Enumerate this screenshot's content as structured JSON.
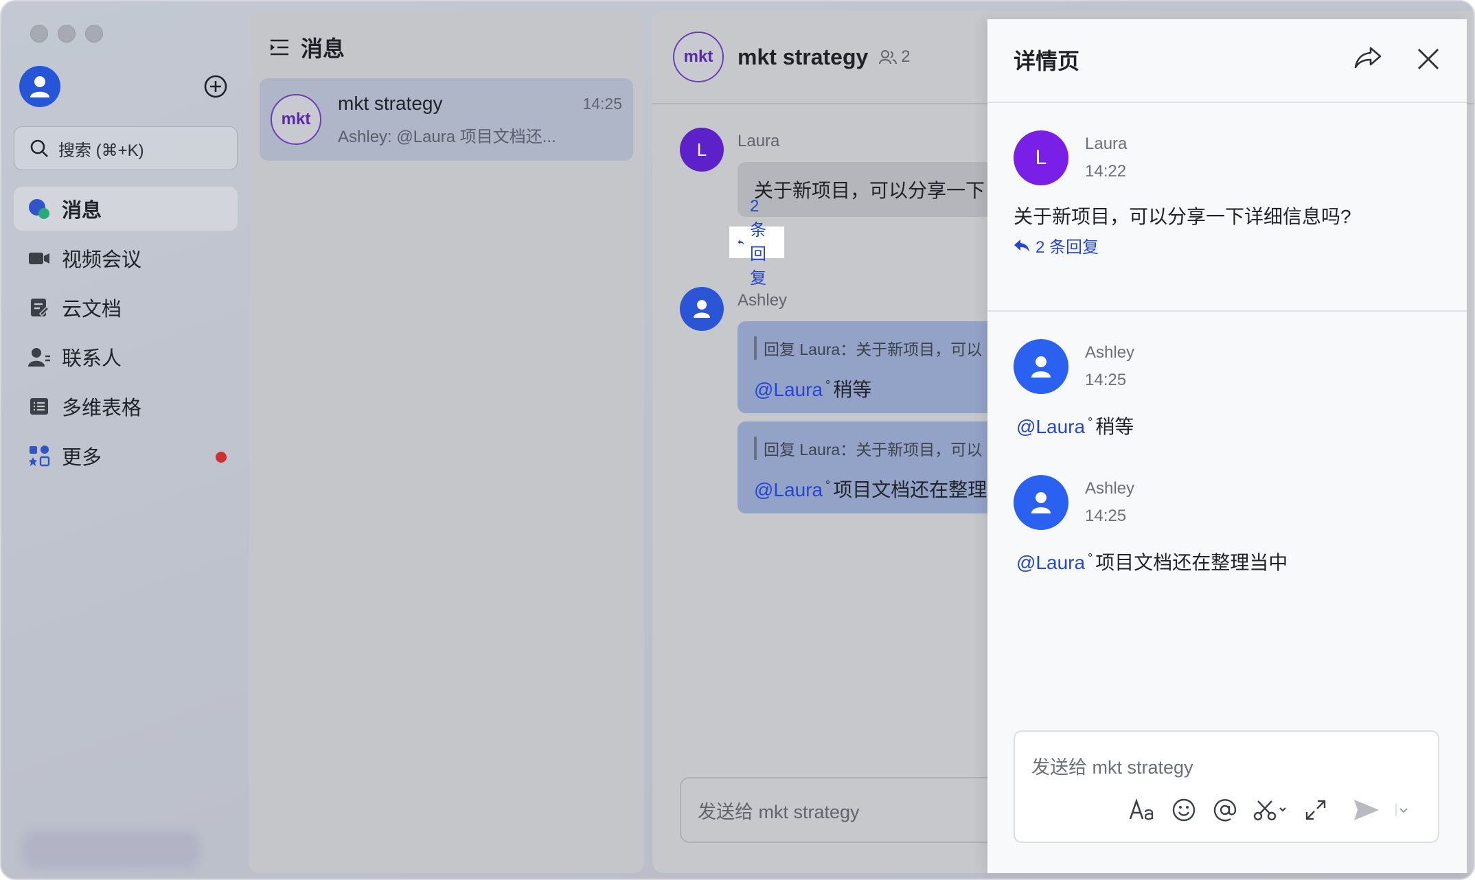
{
  "sidebar": {
    "search_placeholder": "搜索 (⌘+K)",
    "items": [
      {
        "label": "消息",
        "icon": "chat-bubbles-icon",
        "active": true
      },
      {
        "label": "视频会议",
        "icon": "video-camera-icon"
      },
      {
        "label": "云文档",
        "icon": "cloud-document-icon"
      },
      {
        "label": "联系人",
        "icon": "contacts-icon"
      },
      {
        "label": "多维表格",
        "icon": "table-icon"
      },
      {
        "label": "更多",
        "icon": "apps-more-icon",
        "badge": "red-dot"
      }
    ]
  },
  "message_list": {
    "title": "消息",
    "conversations": [
      {
        "avatar": "mkt",
        "name": "mkt strategy",
        "time": "14:25",
        "preview": "Ashley: @Laura 项目文档还..."
      }
    ]
  },
  "chat": {
    "avatar": "mkt",
    "title": "mkt strategy",
    "member_count": "2",
    "messages": [
      {
        "sender": "Laura",
        "avatar": "L",
        "text": "关于新项目，可以分享一下",
        "reply_count": "2 条回复"
      },
      {
        "sender": "Ashley",
        "quote1": "回复 Laura：关于新项目，可以",
        "mention1": "@Laura",
        "text1": "稍等",
        "quote2": "回复 Laura：关于新项目，可以",
        "mention2": "@Laura",
        "text2": "项目文档还在整理"
      }
    ],
    "input_placeholder": "发送给 mkt strategy"
  },
  "detail": {
    "title": "详情页",
    "root": {
      "sender": "Laura",
      "avatar": "L",
      "time": "14:22",
      "text": "关于新项目，可以分享一下详细信息吗?",
      "reply_count": "2 条回复"
    },
    "replies": [
      {
        "sender": "Ashley",
        "time": "14:25",
        "mention": "@Laura",
        "text": "稍等"
      },
      {
        "sender": "Ashley",
        "time": "14:25",
        "mention": "@Laura",
        "text": "项目文档还在整理当中"
      }
    ],
    "input_placeholder": "发送给 mkt strategy"
  },
  "colors": {
    "accent_blue": "#2546d3",
    "avatar_purple": "#7a1fe8",
    "avatar_blue": "#2a61f0",
    "badge_red": "#d1302f"
  }
}
